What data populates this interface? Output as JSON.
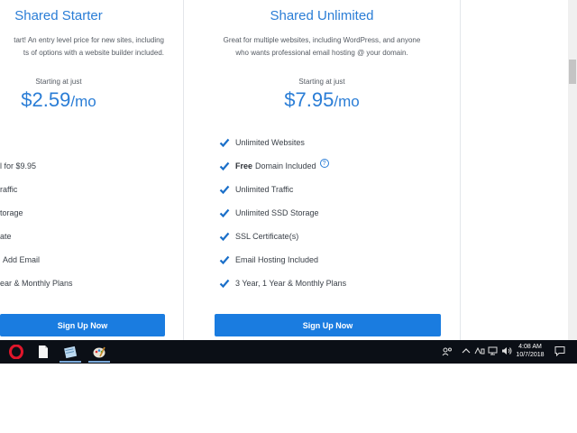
{
  "plans": [
    {
      "name": "Shared Starter",
      "description_lines": [
        "tart! An entry level price for new sites, including",
        "ts of options with a website builder included."
      ],
      "starting_label": "Starting at just",
      "price_amount": "$2.59",
      "price_unit": "/mo",
      "features": [
        {
          "bold": "",
          "text": "l for $9.95"
        },
        {
          "bold": "",
          "text": "raffic"
        },
        {
          "bold": "",
          "text": "torage"
        },
        {
          "bold": "",
          "text": "ate"
        },
        {
          "bold": "",
          "text": "Add Email"
        },
        {
          "bold": "",
          "text": "ear & Monthly Plans"
        }
      ],
      "cta": "Sign Up Now"
    },
    {
      "name": "Shared Unlimited",
      "description_lines": [
        "Great for multiple websites, including WordPress, and anyone",
        "who wants professional email hosting @ your domain."
      ],
      "starting_label": "Starting at just",
      "price_amount": "$7.95",
      "price_unit": "/mo",
      "features": [
        {
          "bold": "",
          "text": "Unlimited Websites"
        },
        {
          "bold": "Free",
          "text": "Domain Included",
          "help": "?"
        },
        {
          "bold": "",
          "text": "Unlimited Traffic"
        },
        {
          "bold": "",
          "text": "Unlimited SSD Storage"
        },
        {
          "bold": "",
          "text": "SSL Certificate(s)"
        },
        {
          "bold": "",
          "text": "Email Hosting Included"
        },
        {
          "bold": "",
          "text": "3 Year, 1 Year & Monthly Plans"
        }
      ],
      "cta": "Sign Up Now"
    }
  ],
  "taskbar": {
    "apps": [
      "opera-icon",
      "file-icon",
      "notepad-icon",
      "paint-icon"
    ],
    "tray": {
      "time": "4:08 AM",
      "date": "10/7/2018"
    }
  },
  "colors": {
    "accent": "#2a7dd6",
    "button": "#1a7ce0",
    "taskbar": "#0b0f16"
  }
}
